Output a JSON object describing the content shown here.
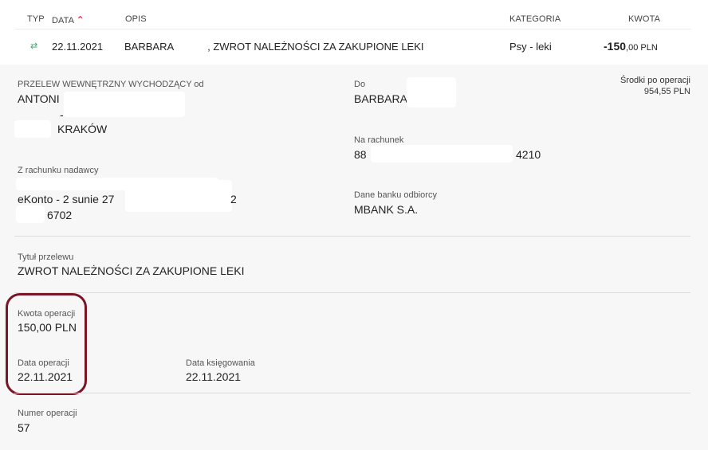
{
  "header": {
    "typ": "TYP",
    "data": "DATA",
    "opis": "OPIS",
    "kategoria": "KATEGORIA",
    "kwota": "KWOTA"
  },
  "transaction": {
    "date": "22.11.2021",
    "desc_name": "BARBARA",
    "desc_rest": ", ZWROT NALEŻNOŚCI ZA ZAKUPIONE LEKI",
    "category": "Psy - leki",
    "amount_int": "-150",
    "amount_dec": ",00 PLN"
  },
  "details": {
    "transfer_type": "PRZELEW WEWNĘTRZNY WYCHODZĄCY od",
    "sender_name": "ANTONI",
    "sender_dash": "-",
    "sender_city": "KRAKÓW",
    "to_label": "Do",
    "to_name": "BARBARA",
    "balance_label": "Środki po operacji",
    "balance_value": "954,55 PLN",
    "account_label": "Na rachunek",
    "account_prefix": "88",
    "account_suffix": "4210",
    "from_account_label": "Z rachunku nadawcy",
    "from_account_name": "eKonto - 2 sunie 27",
    "from_account_frag": "2",
    "from_account_last": "6702",
    "bank_label": "Dane banku odbiorcy",
    "bank_value": "MBANK S.A.",
    "title_label": "Tytuł przelewu",
    "title_value": "ZWROT NALEŻNOŚCI ZA ZAKUPIONE LEKI",
    "amount_label": "Kwota operacji",
    "amount_value": "150,00 PLN",
    "op_date_label": "Data operacji",
    "op_date_value": "22.11.2021",
    "booking_label": "Data księgowania",
    "booking_value": "22.11.2021",
    "number_label": "Numer operacji",
    "number_value": "57"
  }
}
